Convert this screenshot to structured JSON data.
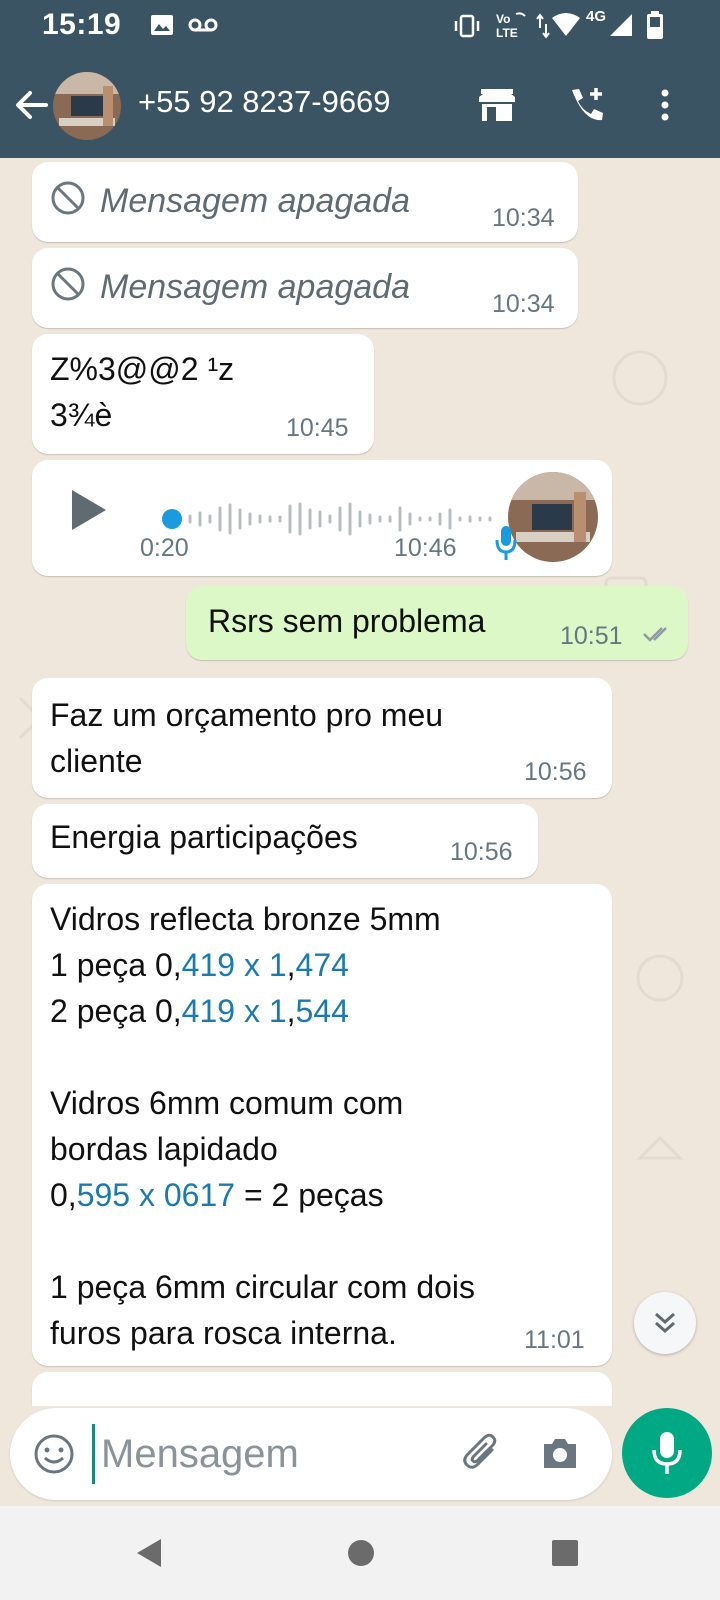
{
  "status_bar": {
    "time": "15:19",
    "network": "4G"
  },
  "header": {
    "contact": "+55 92 8237-9669"
  },
  "messages": [
    {
      "type": "deleted",
      "text": "Mensagem apagada",
      "time": "10:34"
    },
    {
      "type": "deleted",
      "text": "Mensagem apagada",
      "time": "10:34"
    },
    {
      "type": "text",
      "text": "Z%3@@2 ¹z\n3¾è",
      "time": "10:45"
    },
    {
      "type": "audio",
      "duration": "0:20",
      "time": "10:46",
      "progress": 0.0
    },
    {
      "type": "text_out",
      "text": "Rsrs sem problema",
      "time": "10:51"
    },
    {
      "type": "text",
      "text": "Faz um orçamento pro meu\ncliente",
      "time": "10:56"
    },
    {
      "type": "text",
      "text": "Energia participações",
      "time": "10:56"
    },
    {
      "type": "long_text",
      "time": "11:01",
      "lines": [
        {
          "pre": "Vidros reflecta bronze 5mm",
          "link": "",
          "post": ""
        },
        {
          "pre": "1 peça 0,",
          "link": "419 x 1",
          "post": ",",
          "link2": "474"
        },
        {
          "pre": "2 peça 0,",
          "link": "419 x 1",
          "post": ",",
          "link2": "544"
        },
        {
          "pre": "",
          "link": "",
          "post": ""
        },
        {
          "pre": "Vidros 6mm comum com",
          "link": "",
          "post": ""
        },
        {
          "pre": "bordas lapidado",
          "link": "",
          "post": ""
        },
        {
          "pre": "0,",
          "link": "595 x 0617",
          "post": " = 2 peças"
        },
        {
          "pre": "",
          "link": "",
          "post": ""
        },
        {
          "pre": "1 peça 6mm circular com dois",
          "link": "",
          "post": ""
        },
        {
          "pre": "furos para rosca interna.",
          "link": "",
          "post": ""
        }
      ]
    }
  ],
  "composer": {
    "placeholder": "Mensagem"
  },
  "colors": {
    "header": "#3b5463",
    "outgoing": "#dcf8c6",
    "accent": "#00a884",
    "link": "#1a7bb0"
  },
  "icons": {
    "back": "arrow-back-icon",
    "store": "store-icon",
    "call": "add-call-icon",
    "menu": "more-vert-icon",
    "deleted": "blocked-icon",
    "play": "play-icon",
    "mic": "mic-icon",
    "emoji": "emoji-icon",
    "attach": "paperclip-icon",
    "camera": "camera-icon",
    "scroll": "double-chevron-down-icon"
  }
}
